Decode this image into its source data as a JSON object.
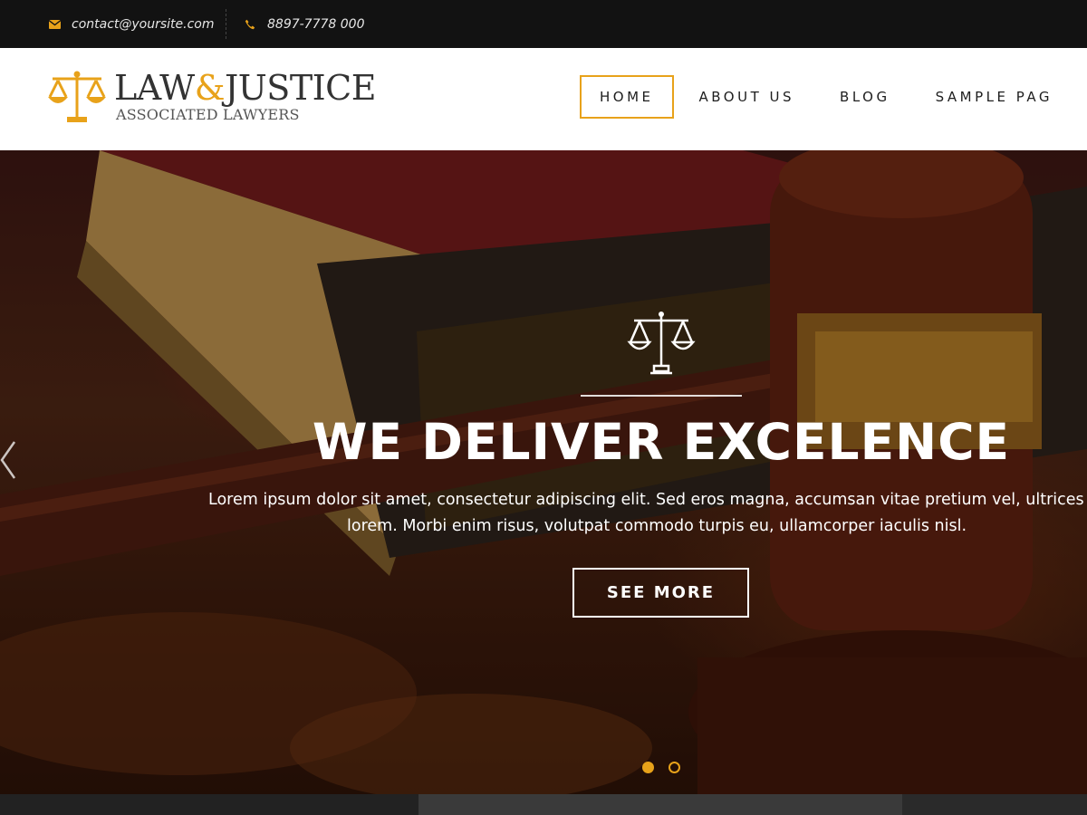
{
  "topbar": {
    "email": "contact@yoursite.com",
    "phone": "8897-7778 000",
    "email_icon": "envelope-icon",
    "phone_icon": "phone-icon"
  },
  "logo": {
    "title_part1": "LAW",
    "title_amp": "&",
    "title_part2": "JUSTICE",
    "subtitle": "ASSOCIATED LAWYERS",
    "icon": "scales-icon"
  },
  "nav": {
    "items": [
      {
        "label": "HOME",
        "active": true
      },
      {
        "label": "ABOUT US",
        "active": false
      },
      {
        "label": "BLOG",
        "active": false
      },
      {
        "label": "SAMPLE PAG",
        "active": false
      }
    ]
  },
  "hero": {
    "icon": "scales-icon",
    "title": "WE DELIVER EXCELENCE",
    "desc_line1": "Lorem ipsum dolor sit amet, consectetur adipiscing elit. Sed eros magna, accumsan vitae pretium vel, ultrices",
    "desc_line2": "lorem. Morbi enim risus, volutpat commodo turpis eu, ullamcorper iaculis nisl.",
    "button": "SEE MORE",
    "slides": 2,
    "active_slide": 1
  },
  "colors": {
    "accent": "#e8a21a",
    "topbar_bg": "#121212",
    "header_bg": "#ffffff"
  }
}
